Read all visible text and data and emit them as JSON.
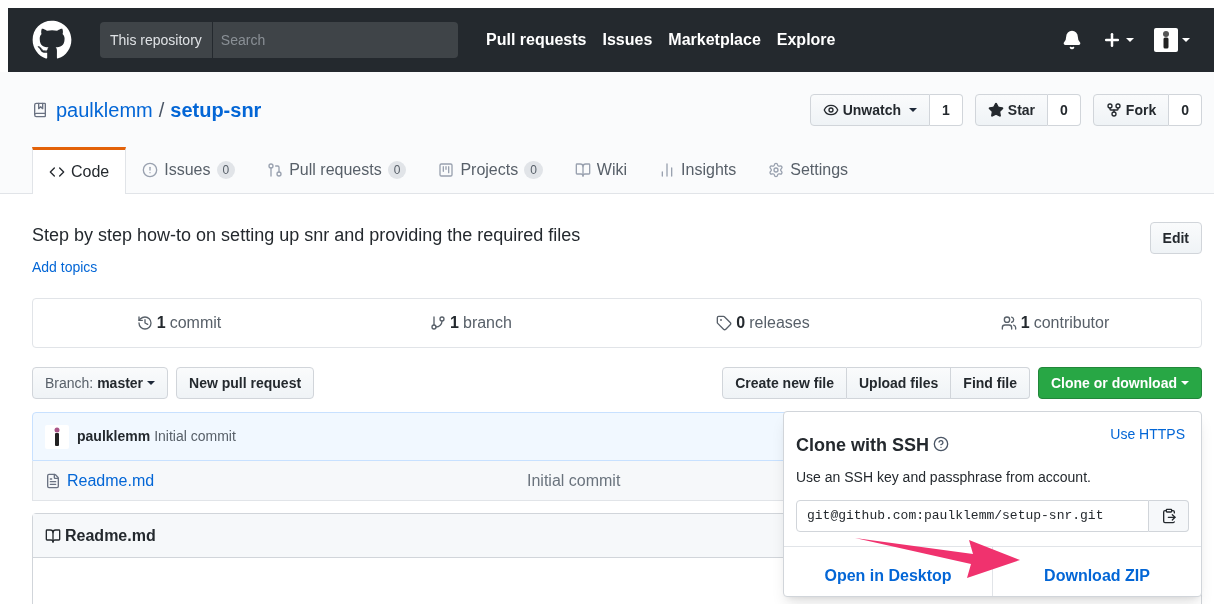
{
  "header": {
    "search_scope": "This repository",
    "search_placeholder": "Search",
    "nav": [
      "Pull requests",
      "Issues",
      "Marketplace",
      "Explore"
    ]
  },
  "repo": {
    "owner": "paulklemm",
    "separator": "/",
    "name": "setup-snr",
    "actions": [
      {
        "kind": "watch",
        "label": "Unwatch",
        "count": "1"
      },
      {
        "kind": "star",
        "label": "Star",
        "count": "0"
      },
      {
        "kind": "fork",
        "label": "Fork",
        "count": "0"
      }
    ],
    "tabs": [
      {
        "kind": "code",
        "label": "Code",
        "selected": true
      },
      {
        "kind": "issues",
        "label": "Issues",
        "count": "0",
        "selected": false
      },
      {
        "kind": "pulls",
        "label": "Pull requests",
        "count": "0",
        "selected": false
      },
      {
        "kind": "projects",
        "label": "Projects",
        "count": "0",
        "selected": false
      },
      {
        "kind": "wiki",
        "label": "Wiki",
        "selected": false
      },
      {
        "kind": "insights",
        "label": "Insights",
        "selected": false
      },
      {
        "kind": "settings",
        "label": "Settings",
        "selected": false
      }
    ]
  },
  "description": "Step by step how-to on setting up snr and providing the required files",
  "add_topics": "Add topics",
  "edit_button": "Edit",
  "summary": [
    {
      "kind": "commits",
      "count": "1",
      "label": "commit"
    },
    {
      "kind": "branches",
      "count": "1",
      "label": "branch"
    },
    {
      "kind": "releases",
      "count": "0",
      "label": "releases"
    },
    {
      "kind": "contributors",
      "count": "1",
      "label": "contributor"
    }
  ],
  "branch": {
    "label": "Branch:",
    "value": "master"
  },
  "new_pull_request": "New pull request",
  "file_buttons": [
    "Create new file",
    "Upload files",
    "Find file"
  ],
  "clone_button": "Clone or download",
  "commit": {
    "author": "paulklemm",
    "message": "Initial commit"
  },
  "files": [
    {
      "name": "Readme.md",
      "message": "Initial commit"
    }
  ],
  "readme_title": "Readme.md",
  "popover": {
    "title": "Clone with SSH",
    "switch_link": "Use HTTPS",
    "description": "Use an SSH key and passphrase from account.",
    "url": "git@github.com:paulklemm/setup-snr.git",
    "open_desktop": "Open in Desktop",
    "download_zip": "Download ZIP"
  }
}
